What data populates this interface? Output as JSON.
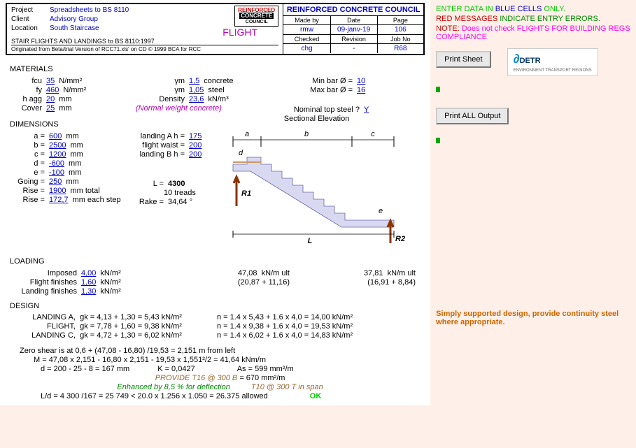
{
  "header": {
    "project_label": "Project",
    "project": "Spreadsheets to BS 8110",
    "client_label": "Client",
    "client": "Advisory Group",
    "location_label": "Location",
    "location": "South Staircase",
    "flight": "FLIGHT",
    "subtitle": "STAIR FLIGHTS AND LANDINGS to BS 8110:1997",
    "origin": "Originated from Beta/trial Version of RCC71.xls'   on CD    © 1999 BCA for RCC",
    "council_title": "REINFORCED CONCRETE COUNCIL",
    "made_by_label": "Made by",
    "made_by": "rmw",
    "date_label": "Date",
    "date": "09-janv-19",
    "page_label": "Page",
    "page": "106",
    "checked_label": "Checked",
    "checked": "chg",
    "revision_label": "Revision",
    "revision": "-",
    "jobno_label": "Job No",
    "jobno": "R68",
    "logo_top": "REINFORCED",
    "logo_mid": "CONCRETE",
    "logo_bot": "COUNCIL"
  },
  "materials": {
    "title": "MATERIALS",
    "fcu_label": "fcu",
    "fcu": "35",
    "fcu_unit": "N/mm²",
    "fy_label": "fy",
    "fy": "460",
    "fy_unit": "N/mm²",
    "hagg_label": "h agg",
    "hagg": "20",
    "hagg_unit": "mm",
    "cover_label": "Cover",
    "cover": "25",
    "cover_unit": "mm",
    "gm_label": "γm",
    "gm1": "1,5",
    "gm1_mat": "concrete",
    "gm2": "1,05",
    "gm2_mat": "steel",
    "density_label": "Density",
    "density": "23,6",
    "density_unit": "kN/m³",
    "weight_note": "(Normal weight concrete)",
    "minbar_label": "Min bar Ø =",
    "minbar": "10",
    "maxbar_label": "Max bar Ø =",
    "maxbar": "16",
    "nomtop_label": "Nominal top steel ?",
    "nomtop": "Y"
  },
  "dimensions": {
    "title": "DIMENSIONS",
    "sect_title": "Sectional Elevation",
    "a_label": "a =",
    "a": "600",
    "a_unit": "mm",
    "b_label": "b =",
    "b": "2500",
    "b_unit": "mm",
    "c_label": "c =",
    "c": "1200",
    "c_unit": "mm",
    "d_label": "d =",
    "d": "-600",
    "d_unit": "mm",
    "e_label": "e =",
    "e": "-100",
    "e_unit": "mm",
    "going_label": "Going =",
    "going": "250",
    "going_unit": "mm",
    "rise1_label": "Rise =",
    "rise1": "1900",
    "rise1_unit": "mm total",
    "rise2_label": "Rise =",
    "rise2": "172,7",
    "rise2_unit": "mm each step",
    "landA_label": "landing A h =",
    "landA": "175",
    "waist_label": "flight waist =",
    "waist": "200",
    "landB_label": "landing B h =",
    "landB": "200",
    "L_label": "L =",
    "L": "4300",
    "treads": "10 treads",
    "rake_label": "Rake =",
    "rake": "34,64 °"
  },
  "loading": {
    "title": "LOADING",
    "imp_label": "Imposed",
    "imp": "4,00",
    "imp_unit": "kN/m²",
    "ff_label": "Flight finishes",
    "ff": "1,60",
    "ff_unit": "kN/m²",
    "lf_label": "Landing finishes",
    "lf": "1,30",
    "lf_unit": "kN/m²",
    "r1_val": "47,08",
    "r1_unit": "kN/m ult",
    "r1_calc": "(20,87 + 11,16)",
    "r2_val": "37,81",
    "r2_unit": "kN/m ult",
    "r2_calc": "(16,91 + 8,84)"
  },
  "design": {
    "title": "DESIGN",
    "la_label": "LANDING A,",
    "la_gk": "gk = 4,13 + 1,30 = 5,43 kN/m²",
    "la_n": "n = 1.4 x 5,43 + 1.6 x 4,0 = 14,00 kN/m²",
    "fl_label": "FLIGHT,",
    "fl_gk": "gk = 7,78 + 1,60 = 9,38 kN/m²",
    "fl_n": "n = 1.4 x 9,38 + 1.6 x 4,0 = 19,53 kN/m²",
    "lc_label": "LANDING C,",
    "lc_gk": "gk = 4,72 + 1,30 = 6,02 kN/m²",
    "lc_n": "n = 1.4 x 6,02 + 1.6 x 4,0 = 14,83 kN/m²",
    "zero_shear": "Zero shear is at  0,6 + (47,08 - 16,80) /19,53 = 2,151 m from left",
    "M": "M = 47,08 x 2,151 - 16,80 x 2,151 - 19,53 x 1,551²/2 = 41,64 kNm/m",
    "d_calc": "d = 200 - 25 - 8 = 167 mm",
    "K": "K = 0,0427",
    "As": "As = 599 mm²/m",
    "provide_label": "PROVIDE  T16 @ 300 B",
    "provide_val": "= 670 mm²/m",
    "enhance": "Enhanced by 8,5 % for deflection",
    "span": "T10 @ 300 T in span",
    "ld": "L/d = 4 300 /167 = 25 749 < 20.0 x 1.256 x 1.050 = 26.375 allowed",
    "ok": "OK"
  },
  "side": {
    "enter1": "ENTER DATA IN ",
    "enter2": "BLUE CELLS",
    "enter3": " ONLY.",
    "red_msg1": "RED MESSAGES",
    "red_msg2": " INDICATE ENTRY ERRORS.",
    "note1": "NOTE: ",
    "note2": "Does not check FLIGHTS FOR BUILDING REGS COMPLIANCE",
    "print_sheet": "Print  Sheet",
    "print_all": "Print  ALL Output",
    "simply": "Simply supported design, provide continuity steel where appropriate.",
    "detr": "DETR",
    "detr_sub": "ENVIRONMENT\nTRANSPORT\nREGIONS"
  },
  "diagram_labels": {
    "a": "a",
    "b": "b",
    "c": "c",
    "d": "d",
    "e": "e",
    "L": "L",
    "R1": "R1",
    "R2": "R2"
  }
}
